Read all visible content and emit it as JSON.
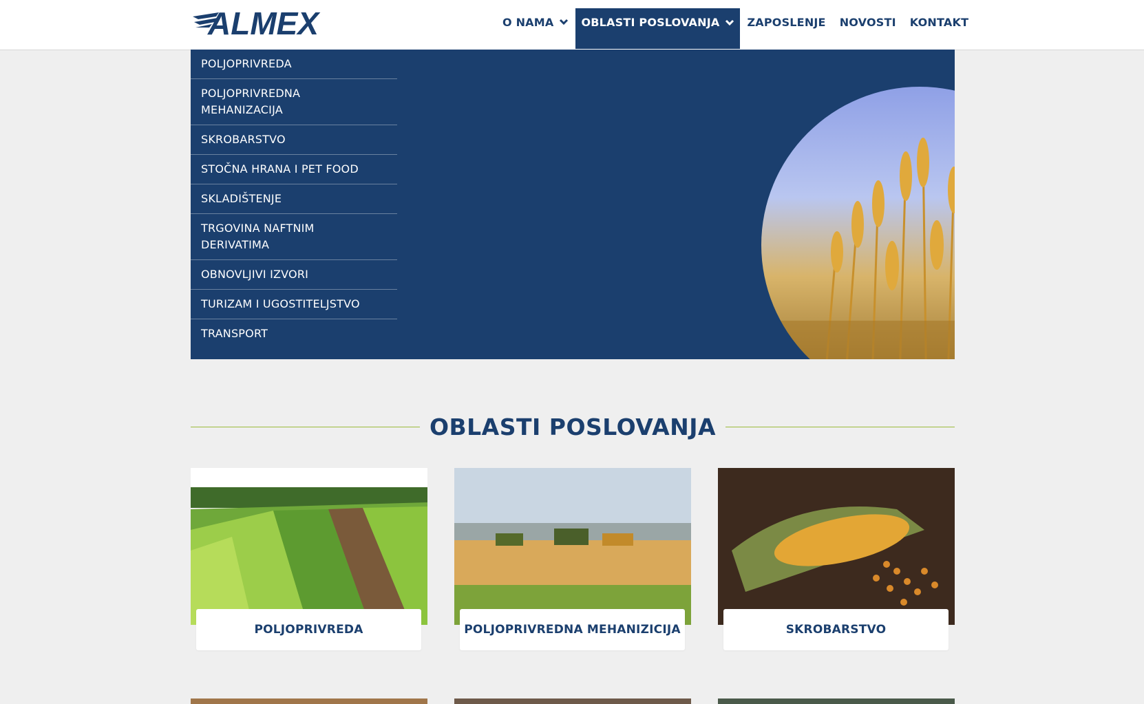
{
  "header": {
    "logo_text": "ALMEX",
    "nav": [
      {
        "label": "O NAMA",
        "has_dropdown": true
      },
      {
        "label": "OBLASTI POSLOVANJA",
        "has_dropdown": true,
        "active": true
      },
      {
        "label": "ZAPOSLENJE"
      },
      {
        "label": "NOVOSTI"
      },
      {
        "label": "KONTAKT"
      }
    ]
  },
  "dropdown": {
    "items": [
      "POLJOPRIVREDA",
      "POLJOPRIVREDNA MEHANIZACIJA",
      "SKROBARSTVO",
      "STOČNA HRANA I PET FOOD",
      "SKLADIŠTENJE",
      "TRGOVINA NAFTNIM DERIVATIMA",
      "OBNOVLJIVI IZVORI",
      "TURIZAM I UGOSTITELJSTVO",
      "TRANSPORT"
    ]
  },
  "section": {
    "title": "OBLASTI POSLOVANJA"
  },
  "cards": [
    {
      "label": "POLJOPRIVREDA",
      "image": "green-fields-photo"
    },
    {
      "label": "POLJOPRIVREDNA MEHANIZICIJA",
      "image": "combine-harvesters-photo"
    },
    {
      "label": "SKROBARSTVO",
      "image": "corn-cob-photo"
    }
  ],
  "colors": {
    "brand_blue": "#1b3f6e",
    "accent_green": "#9bbb3b",
    "page_bg": "#efefef"
  }
}
